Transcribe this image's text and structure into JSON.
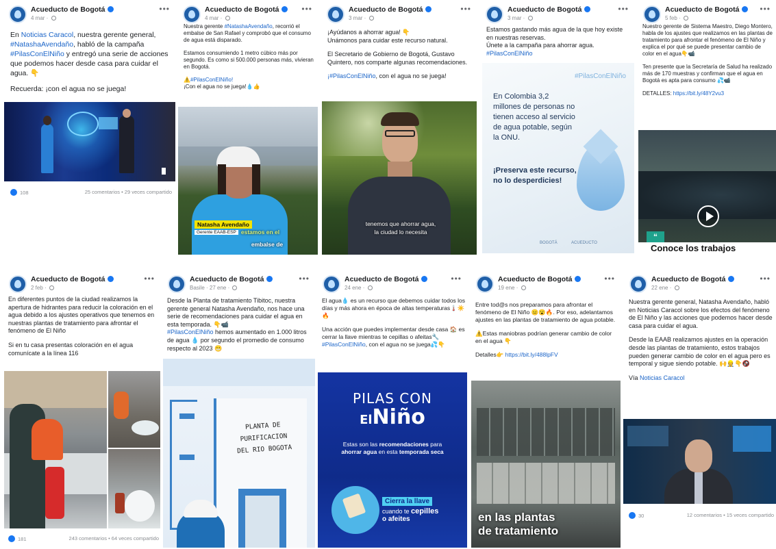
{
  "page_name": "Acueducto de Bogotá",
  "posts": [
    {
      "date": "4 mar",
      "text_parts": [
        {
          "t": "En "
        },
        {
          "t": "Noticias Caracol",
          "link": true
        },
        {
          "t": ", nuestra gerente general, "
        },
        {
          "t": "#NatashaAvendaño",
          "link": true
        },
        {
          "t": ", habló de la campaña "
        },
        {
          "t": "#PilasConElNiño",
          "link": true
        },
        {
          "t": " y entregó una serie de acciones que podemos hacer desde casa para cuidar el agua. 👇"
        }
      ],
      "text2": "Recuerda: ¡con el agua no se juega!",
      "likes": "108",
      "stats": "25 comentarios • 29 veces compartido"
    },
    {
      "date": "4 mar",
      "p1_a": "Nuestra gerente ",
      "p1_link": "#NatashaAvendaño",
      "p1_b": ", recorrió el embalse de San Rafael y comprobó que el consumo de agua está disparado.",
      "p2": "Estamos consumiendo 1 metro cúbico más por segundo. Es como si 500.000 personas más, vivieran en Bogotá.",
      "p3_link": "⚠️#PilasConElNiño!",
      "p4": "¡Con el agua no se juega!💧👍",
      "caption_name": "Natasha Avendaño",
      "caption_role": "Gerente EAAB-ESP",
      "caption_line1": "estamos en el",
      "caption_line2": "embalse de"
    },
    {
      "date": "3 mar",
      "p1": "¡Ayúdanos a ahorrar agua! 👇\nUnámonos para cuidar este recurso natural.",
      "p2": "El Secretario de Gobierno de Bogotá, Gustavo Quintero, nos comparte algunas recomendaciones.",
      "p3_link": "¡#PilasConElNiño",
      "p3_b": ", con el agua no se juega!",
      "subtitle1": "tenemos que ahorrar agua,",
      "subtitle2": "la ciudad lo necesita"
    },
    {
      "date": "3 mar",
      "p1": "Estamos gastando más agua de la que hoy existe en nuestras reservas.\nÚnete a la campaña para ahorrar agua.",
      "p1_link": "#PilasConElNiño",
      "tag": "#PilasConElNiño",
      "body": "En Colombia 3,2 millones de personas no tienen acceso al servicio de agua potable, según la ONU.",
      "bold": "¡Preserva este recurso, no lo desperdicies!",
      "logo1": "BOGOTÁ",
      "logo2": "ACUEDUCTO"
    },
    {
      "date": "5 feb",
      "p1": "Nuestro gerente de Sistema Maestro, Diego Montero, habla de los ajustes que realizamos en las plantas de tratamiento para afrontar el fenómeno de El Niño y explica el por qué se puede presentar cambio de color en el agua👇📹",
      "p2": "Ten presente que la Secretaría de Salud ha realizado más de 170 muestras y confirman que el agua en Bogotá es apta para consumo 💦📹",
      "p3": "DETALLES: ",
      "p3_link": "https://bit.ly/48Y2vu3",
      "banner": "Conoce los trabajos"
    },
    {
      "date": "2 feb",
      "p1": "En diferentes puntos de la ciudad realizamos la apertura de hidrantes para reducir la coloración en el agua debido a los ajustes operativos que tenemos en nuestras plantas de tratamiento para afrontar el fenómeno de El Niño",
      "p2": "Si en tu casa presentas coloración en el agua comunícate a la línea 116",
      "likes": "181",
      "stats": "243 comentarios • 64 veces compartido"
    },
    {
      "date": "27 ene",
      "editor": "Basile",
      "p1_a": "Desde la Planta de tratamiento Tibitoc, nuestra gerente general Natasha Avendaño, nos hace una serie de recomendaciones para cuidar el agua en esta temporada. 👇📹\n",
      "p1_link": "#PilasConElNiño",
      "p1_b": " hemos aumentado en 1.000 litros de agua 💧 por segundo el promedio de consumo respecto al 2023 😬",
      "sign1": "PLANTA DE",
      "sign2": "PURIFICACION",
      "sign3": "DEL RIO BOGOTA"
    },
    {
      "date": "24 ene",
      "p1": "El agua💧 es un recurso que debemos cuidar todos los días y más ahora en época de altas temperaturas🌡️☀️🔥",
      "p2_a": "Una acción que puedes implementar desde casa 🏠 es cerrar la llave mientras te cepillas o afeitas🔧\n",
      "p2_link": "#PilasConElNiño",
      "p2_b": ", con el agua no se juega💦👇",
      "poster_title1": "PILAS CON",
      "poster_el": "El",
      "poster_nino": "Niño",
      "poster_sub_a": "Estas son las ",
      "poster_sub_b": "recomendaciones",
      "poster_sub_c": " para ",
      "poster_sub_d": "ahorrar agua",
      "poster_sub_e": " en esta ",
      "poster_sub_f": "temporada seca",
      "poster_cta_a": "Cierra la llave",
      "poster_cta_b": "cuando te ",
      "poster_cta_c": "cepilles",
      "poster_cta_d": "o afeites"
    },
    {
      "date": "19 ene",
      "p1": "Entre tod@s nos preparamos para afrontar el fenómeno de El Niño 😐😮🔥. Por eso, adelantamos ajustes en las plantas de tratamiento de agua potable.",
      "p2": "⚠️Estas maniobras podrían generar cambio de color en el agua 👇",
      "p3": "Detalles👉 ",
      "p3_link": "https://bit.ly/488lpFV",
      "overlay1": "en las plantas",
      "overlay2": "de tratamiento"
    },
    {
      "date": "22 ene",
      "p1": "Nuestra gerente general, Natasha Avendaño, habló en Noticias Caracol sobre los efectos del fenómeno de El Niño y las acciones que podemos hacer desde casa para cuidar el agua.",
      "p2": "Desde la EAAB realizamos ajustes en la operación desde las plantas de tratamiento, estos trabajos pueden generar cambio de color en el agua pero es temporal y sigue siendo potable. 🙌👷👇🚱",
      "p3": "Vía ",
      "p3_link": "Noticias Caracol",
      "likes": "30",
      "stats": "12 comentarios • 15 veces compartido"
    }
  ],
  "colors": {
    "facebook_blue": "#1877f2",
    "link": "#1a64c8",
    "acueducto_blue": "#1f5fa8",
    "poster_navy": "#102e8c"
  }
}
